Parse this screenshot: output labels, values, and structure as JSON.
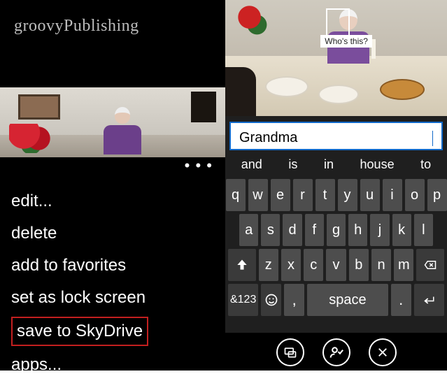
{
  "watermark": "groovyPublishing",
  "left": {
    "ellipsis": "• • •",
    "menu": [
      {
        "label": "edit...",
        "highlight": false
      },
      {
        "label": "delete",
        "highlight": false
      },
      {
        "label": "add to favorites",
        "highlight": false
      },
      {
        "label": "set as lock screen",
        "highlight": false
      },
      {
        "label": "save to SkyDrive",
        "highlight": true
      },
      {
        "label": "apps...",
        "highlight": false
      }
    ]
  },
  "right": {
    "face_tag": "Who's this?",
    "input_value": "Grandma ",
    "suggestions": [
      "and",
      "is",
      "in",
      "house",
      "to"
    ],
    "keyboard": {
      "row1": [
        "q",
        "w",
        "e",
        "r",
        "t",
        "y",
        "u",
        "i",
        "o",
        "p"
      ],
      "row2": [
        "a",
        "s",
        "d",
        "f",
        "g",
        "h",
        "j",
        "k",
        "l"
      ],
      "row3_mid": [
        "z",
        "x",
        "c",
        "v",
        "b",
        "n",
        "m"
      ],
      "sym": "&123",
      "comma": ",",
      "space": "space",
      "period": "."
    },
    "appbar": [
      "tag-icon",
      "accept-icon",
      "cancel-icon"
    ]
  }
}
